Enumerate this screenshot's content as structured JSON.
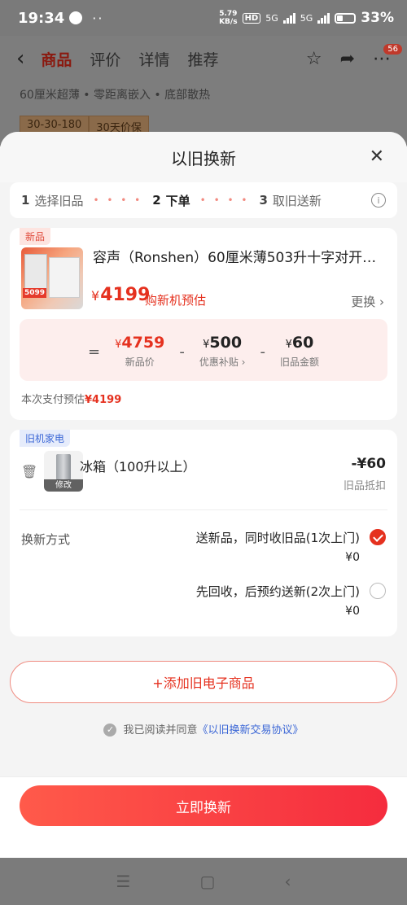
{
  "status": {
    "time": "19:34",
    "dots": "··",
    "net_speed": "5.79",
    "net_unit": "KB/s",
    "hd": "HD",
    "sig1": "5G",
    "sig2": "5G",
    "battery": "33%"
  },
  "background_page": {
    "tabs": [
      "商品",
      "评价",
      "详情",
      "推荐"
    ],
    "badge": "56",
    "features": "60厘米超薄  •  零距离嵌入  •  底部散热",
    "tags": [
      "30-30-180",
      "30天价保"
    ]
  },
  "sheet": {
    "title": "以旧换新",
    "steps": [
      {
        "num": "1",
        "label": "选择旧品"
      },
      {
        "num": "2",
        "label": "下单"
      },
      {
        "num": "3",
        "label": "取旧送新"
      }
    ],
    "step_dots": "• • • •"
  },
  "product": {
    "tag": "新品",
    "thumb_price": "5099",
    "name": "容声（Ronshen）60厘米薄503升十字对开门...",
    "currency": "¥",
    "price": "4199",
    "price_label": "购新机预估",
    "replace": "更换 ›",
    "calc": {
      "eq": "=",
      "new_price": "4759",
      "new_price_label": "新品价",
      "minus": "-",
      "subsidy": "500",
      "subsidy_label": "优惠补贴 ›",
      "old_value": "60",
      "old_value_label": "旧品金额"
    },
    "pay_label": "本次支付预估",
    "pay_value": "¥4199"
  },
  "old_item": {
    "tag": "旧机家电",
    "name": "冰箱（100升以上）",
    "edit": "修改",
    "price": "-¥60",
    "price_sub": "旧品抵扣",
    "method_label": "换新方式",
    "options": [
      {
        "title": "送新品，同时收旧品(1次上门)",
        "price": "¥0",
        "selected": true
      },
      {
        "title": "先回收，后预约送新(2次上门)",
        "price": "¥0",
        "selected": false
      }
    ]
  },
  "add_button": "+添加旧电子商品",
  "agreement": {
    "text": "我已阅读并同意",
    "link": "《以旧换新交易协议》"
  },
  "submit_button": "立即换新",
  "colors": {
    "accent": "#e5311f",
    "link": "#3a66d6"
  }
}
